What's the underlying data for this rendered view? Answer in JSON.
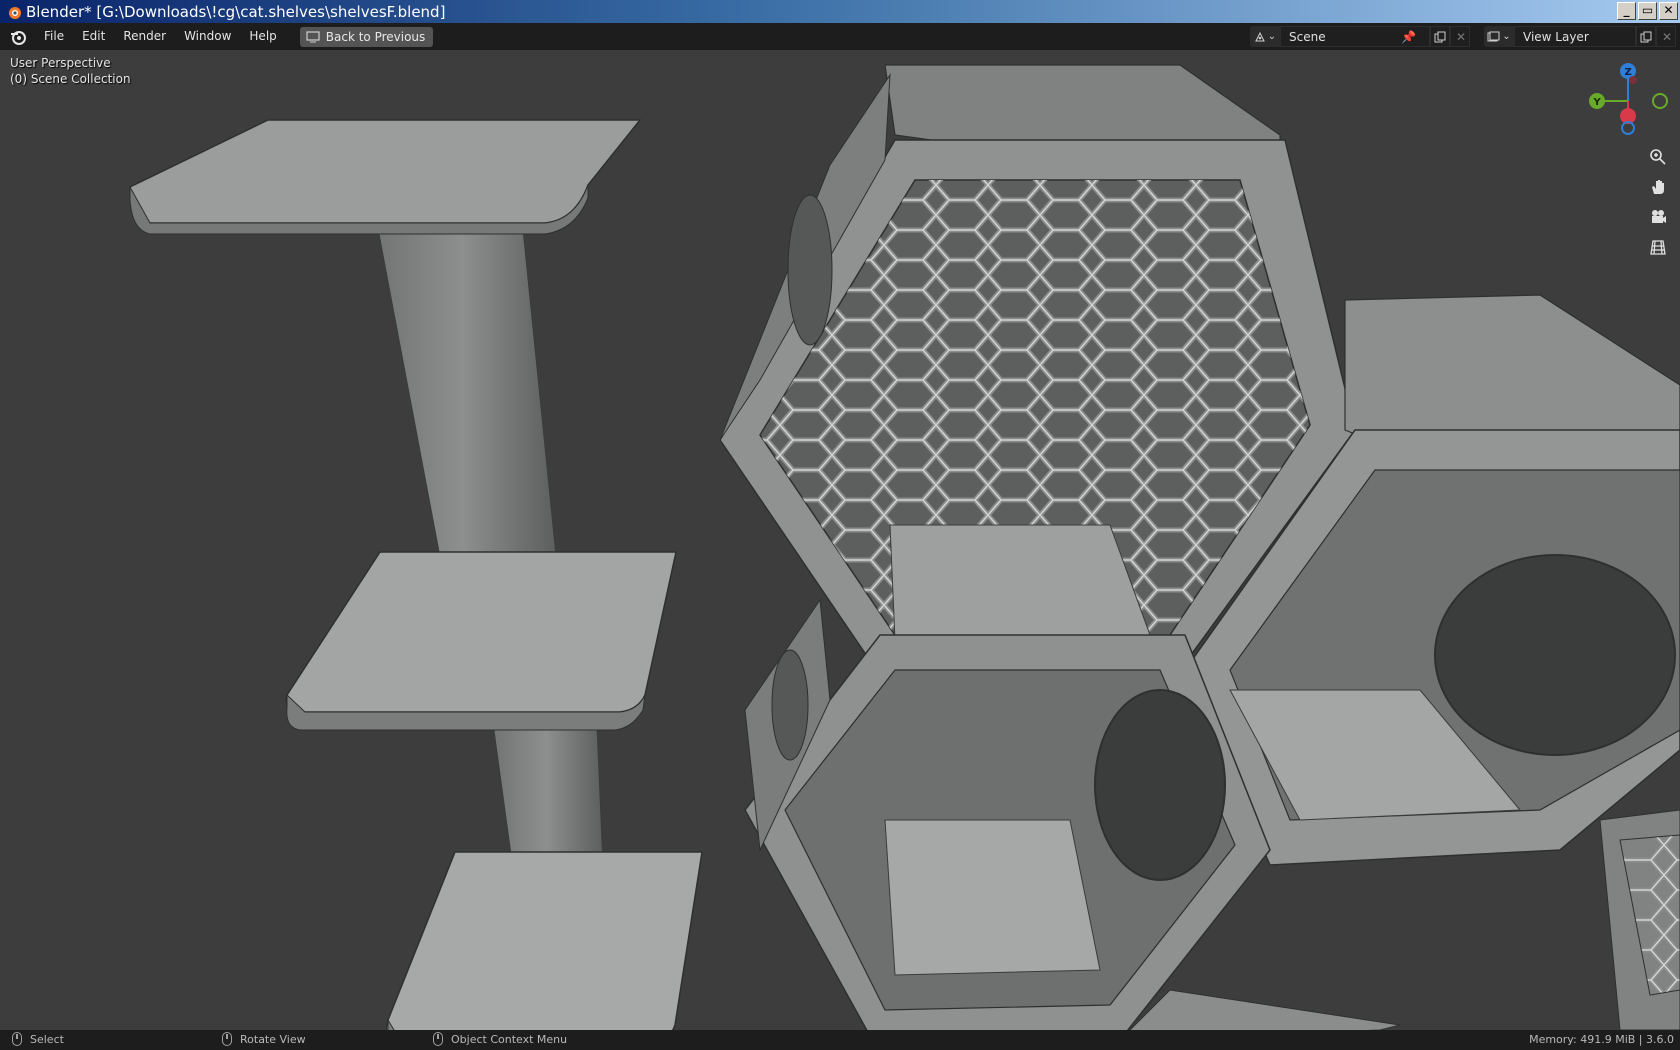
{
  "window": {
    "title": "Blender* [G:\\Downloads\\!cg\\cat.shelves\\shelvesF.blend]",
    "minimize": "_",
    "restore": "▭",
    "close": "✕"
  },
  "topbar": {
    "menus": [
      "File",
      "Edit",
      "Render",
      "Window",
      "Help"
    ],
    "back_button": "Back to Previous",
    "scene": "Scene",
    "view_layer": "View Layer"
  },
  "viewport": {
    "perspective": "User Perspective",
    "collection": "(0) Scene Collection",
    "gizmo": {
      "z": "Z",
      "y": "Y"
    },
    "nav_icons": [
      "zoom-icon",
      "hand-pan-icon",
      "camera-icon",
      "grid-icon"
    ]
  },
  "statusbar": {
    "select": "Select",
    "rotate": "Rotate View",
    "context_menu": "Object Context Menu",
    "memory": "Memory: 491.9 MiB | 3.6.0"
  },
  "colors": {
    "titlebar_start": "#0a246a",
    "titlebar_end": "#a6caf0",
    "topbar_bg": "#1d1d1d",
    "viewport_bg": "#3d3d3d",
    "axis_z": "#2f7fd8",
    "axis_y": "#6aaa2a",
    "axis_x": "#d83a4a"
  }
}
